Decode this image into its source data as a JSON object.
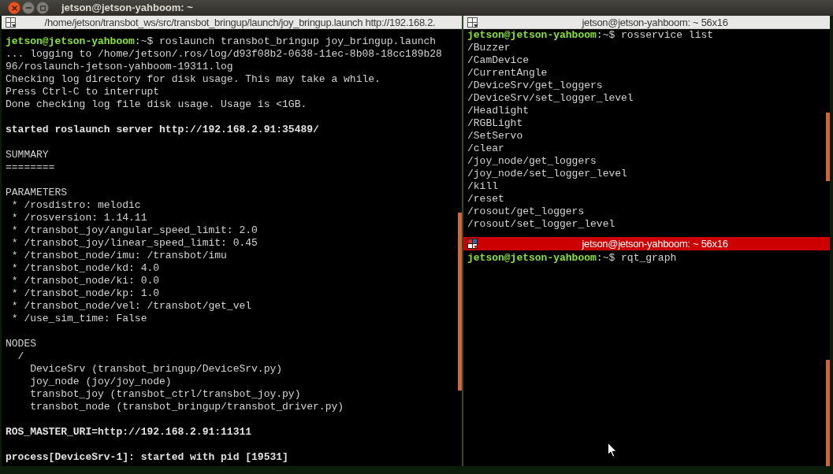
{
  "window": {
    "title": "jetson@jetson-yahboom: ~"
  },
  "panes": [
    {
      "title": "/home/jetson/transbot_ws/src/transbot_bringup/launch/joy_bringup.launch http://192.168.2.",
      "focused": false,
      "lines": [
        {
          "kind": "prompt",
          "user": "jetson@jetson-yahboom",
          "text": ":~$ roslaunch transbot_bringup joy_bringup.launch"
        },
        {
          "kind": "output",
          "text": "... logging to /home/jetson/.ros/log/d93f08b2-0638-11ec-8b08-18cc189b28"
        },
        {
          "kind": "output",
          "text": "96/roslaunch-jetson-yahboom-19311.log"
        },
        {
          "kind": "output",
          "text": "Checking log directory for disk usage. This may take a while."
        },
        {
          "kind": "output",
          "text": "Press Ctrl-C to interrupt"
        },
        {
          "kind": "output",
          "text": "Done checking log file disk usage. Usage is <1GB."
        },
        {
          "kind": "blank"
        },
        {
          "kind": "bold",
          "text": "started roslaunch server http://192.168.2.91:35489/"
        },
        {
          "kind": "blank"
        },
        {
          "kind": "output",
          "text": "SUMMARY"
        },
        {
          "kind": "output",
          "text": "========"
        },
        {
          "kind": "blank"
        },
        {
          "kind": "output",
          "text": "PARAMETERS"
        },
        {
          "kind": "output",
          "text": " * /rosdistro: melodic"
        },
        {
          "kind": "output",
          "text": " * /rosversion: 1.14.11"
        },
        {
          "kind": "output",
          "text": " * /transbot_joy/angular_speed_limit: 2.0"
        },
        {
          "kind": "output",
          "text": " * /transbot_joy/linear_speed_limit: 0.45"
        },
        {
          "kind": "output",
          "text": " * /transbot_node/imu: /transbot/imu"
        },
        {
          "kind": "output",
          "text": " * /transbot_node/kd: 4.0"
        },
        {
          "kind": "output",
          "text": " * /transbot_node/ki: 0.0"
        },
        {
          "kind": "output",
          "text": " * /transbot_node/kp: 1.0"
        },
        {
          "kind": "output",
          "text": " * /transbot_node/vel: /transbot/get_vel"
        },
        {
          "kind": "output",
          "text": " * /use_sim_time: False"
        },
        {
          "kind": "blank"
        },
        {
          "kind": "output",
          "text": "NODES"
        },
        {
          "kind": "output",
          "text": "  /"
        },
        {
          "kind": "output",
          "text": "    DeviceSrv (transbot_bringup/DeviceSrv.py)"
        },
        {
          "kind": "output",
          "text": "    joy_node (joy/joy_node)"
        },
        {
          "kind": "output",
          "text": "    transbot_joy (transbot_ctrl/transbot_joy.py)"
        },
        {
          "kind": "output",
          "text": "    transbot_node (transbot_bringup/transbot_driver.py)"
        },
        {
          "kind": "blank"
        },
        {
          "kind": "bold",
          "text": "ROS_MASTER_URI=http://192.168.2.91:11311"
        },
        {
          "kind": "blank"
        },
        {
          "kind": "bold",
          "text": "process[DeviceSrv-1]: started with pid [19531]"
        }
      ]
    },
    {
      "title": "jetson@jetson-yahboom: ~ 56x16",
      "focused": false,
      "lines": [
        {
          "kind": "prompt",
          "user": "jetson@jetson-yahboom",
          "text": ":~$ rosservice list"
        },
        {
          "kind": "output",
          "text": "/Buzzer"
        },
        {
          "kind": "output",
          "text": "/CamDevice"
        },
        {
          "kind": "output",
          "text": "/CurrentAngle"
        },
        {
          "kind": "output",
          "text": "/DeviceSrv/get_loggers"
        },
        {
          "kind": "output",
          "text": "/DeviceSrv/set_logger_level"
        },
        {
          "kind": "output",
          "text": "/Headlight"
        },
        {
          "kind": "output",
          "text": "/RGBLight"
        },
        {
          "kind": "output",
          "text": "/SetServo"
        },
        {
          "kind": "output",
          "text": "/clear"
        },
        {
          "kind": "output",
          "text": "/joy_node/get_loggers"
        },
        {
          "kind": "output",
          "text": "/joy_node/set_logger_level"
        },
        {
          "kind": "output",
          "text": "/kill"
        },
        {
          "kind": "output",
          "text": "/reset"
        },
        {
          "kind": "output",
          "text": "/rosout/get_loggers"
        },
        {
          "kind": "output",
          "text": "/rosout/set_logger_level"
        }
      ]
    },
    {
      "title": "jetson@jetson-yahboom: ~ 56x16",
      "focused": true,
      "lines": [
        {
          "kind": "prompt",
          "user": "jetson@jetson-yahboom",
          "text": ":~$ rqt_graph"
        }
      ]
    }
  ]
}
